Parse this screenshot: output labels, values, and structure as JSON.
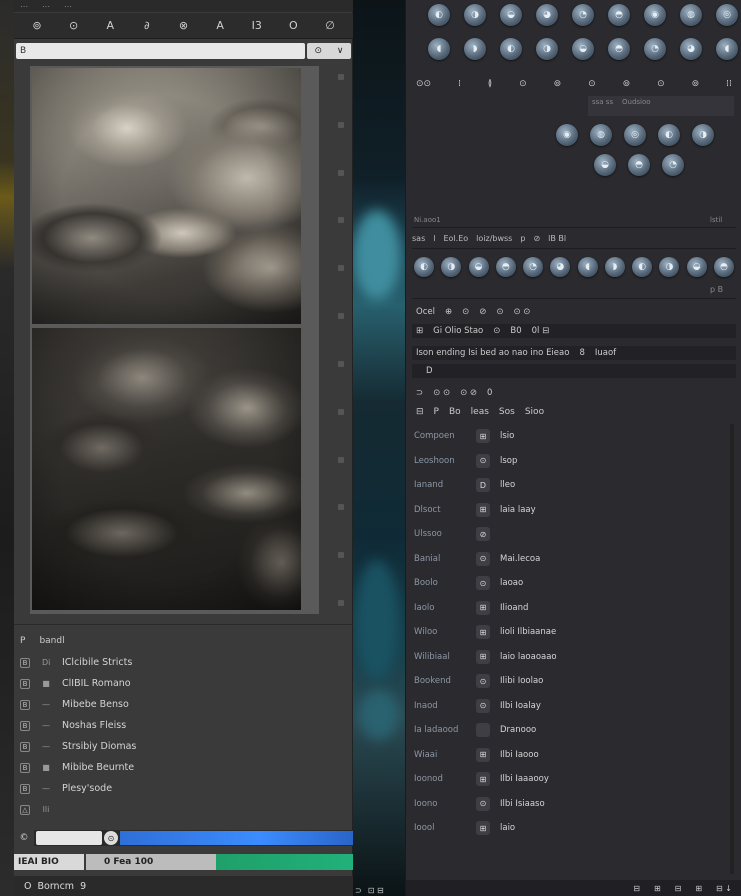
{
  "left_panel": {
    "toolbar_icons": [
      "⊚",
      "⊙",
      "A",
      "∂",
      "⊗",
      "A",
      "I3",
      "O",
      "∅"
    ],
    "path_value": "B",
    "path_buttons": [
      "⊙",
      "∨"
    ],
    "list_header_icon": "P",
    "list_header": "bandl",
    "rows": [
      {
        "mark": "B",
        "bullet": "Di",
        "label": "IClcibile Stricts"
      },
      {
        "mark": "B",
        "bullet": "■",
        "label": "ClIBIL Romano"
      },
      {
        "mark": "B",
        "bullet": "—",
        "label": "Mibebe Benso"
      },
      {
        "mark": "B",
        "bullet": "—",
        "label": "Noshas Fleiss"
      },
      {
        "mark": "B",
        "bullet": "—",
        "label": "Strsibiy Diomas"
      },
      {
        "mark": "B",
        "bullet": "■",
        "label": "Mibibe Beurnte"
      },
      {
        "mark": "B",
        "bullet": "—",
        "label": "Plesy'sode"
      },
      {
        "mark": "△",
        "bullet": "lli",
        "label": ""
      }
    ],
    "progress_cap": "©",
    "progress_btn": "⊙",
    "progress_fill": 1.0,
    "status_seg1": "IEAI BIO",
    "status_seg2": "0 Fea 100",
    "bottom_icon": "O",
    "bottom_label": "Borncm",
    "bottom_extra": "9"
  },
  "right_panel": {
    "palette_row1": [
      "◐",
      "◑",
      "◒",
      "◕",
      "◔",
      "◓",
      "◉",
      "◍",
      "◎"
    ],
    "palette_row2": [
      "◖",
      "◗",
      "◐",
      "◑",
      "◒",
      "◓",
      "◔",
      "◕",
      "◖"
    ],
    "iconbar": [
      "⊙⊙",
      "⁞",
      "≬",
      "⊙",
      "⊚",
      "⊙",
      "⊚",
      "⊙",
      "⊚",
      "⁞⁞"
    ],
    "sub_labels": [
      "ssa ss",
      "Oudsioo"
    ],
    "palette_row3": [
      "◉",
      "◍",
      "◎",
      "◐",
      "◑"
    ],
    "palette_row4": [
      "◒",
      "◓",
      "◔"
    ],
    "small_label_left": "Ni.aoo1",
    "small_label_right": "lstil",
    "tabline": [
      "sas",
      "l",
      "Eol.Eo",
      "loiz/bwss",
      "p",
      "⊘",
      "lB Bl"
    ],
    "colors": [
      "◐",
      "◑",
      "◒",
      "◓",
      "◔",
      "◕",
      "◖",
      "◗",
      "◐",
      "◑",
      "◒",
      "◓"
    ],
    "pill_label": "p B",
    "bar1": [
      "Ocel",
      "⊕",
      "⊙",
      "⊘",
      "⊙",
      "⊙ ⊙"
    ],
    "bar2": [
      "⊞",
      "Gi Olio Stao",
      "⊙",
      "B0",
      "0l ⊟"
    ],
    "bar3": [
      "Ison ending Isi bed ao nao ino Eieao",
      "8",
      "Iuaof"
    ],
    "bar4": [
      "",
      "D"
    ],
    "headbar": [
      "⊃",
      "⊙ ⊙",
      "⊙ ⊘",
      "0"
    ],
    "headrow": [
      "⊟",
      "P",
      "Bo",
      "leas",
      "Sos",
      "Sioo"
    ],
    "props": [
      {
        "label": "Compoen",
        "icon": "⊞",
        "value": "lsio"
      },
      {
        "label": "Leoshoon",
        "icon": "⊙",
        "value": "lsop"
      },
      {
        "label": "Ianand",
        "icon": "D",
        "value": "lleo"
      },
      {
        "label": "Dlsoct",
        "icon": "⊞",
        "value": "laia laay"
      },
      {
        "label": "Ulssoo",
        "icon": "⊘",
        "value": ""
      },
      {
        "label": "Banial",
        "icon": "⊙",
        "value": "Mai.lecoa"
      },
      {
        "label": "Boolo",
        "icon": "⊙",
        "value": "laoao"
      },
      {
        "label": "Iaolo",
        "icon": "⊞",
        "value": "Ilioand"
      },
      {
        "label": "Wiloo",
        "icon": "⊞",
        "value": "lioli Ilbiaanae"
      },
      {
        "label": "Wilibiaal",
        "icon": "⊞",
        "value": "laio laoaoaao"
      },
      {
        "label": "Bookend",
        "icon": "⊙",
        "value": "Ilibi Ioolao"
      },
      {
        "label": "Inaod",
        "icon": "⊙",
        "value": "Ilbi Ioalay"
      },
      {
        "label": "Ia ladaood",
        "icon": "",
        "value": "Dranooo"
      },
      {
        "label": "Wiaai",
        "icon": "⊞",
        "value": "Ilbi Iaooo"
      },
      {
        "label": "Ioonod",
        "icon": "⊞",
        "value": "Ilbi Iaaaooy"
      },
      {
        "label": "Ioono",
        "icon": "⊙",
        "value": "Ilbi Isiaaso"
      },
      {
        "label": "Ioool",
        "icon": "⊞",
        "value": "laio"
      }
    ],
    "footer": [
      "⊟",
      "⊞",
      "⊟",
      "⊞",
      "⊟ ↓"
    ],
    "mid_footer": [
      "⊃",
      "⊡ ⊟"
    ]
  }
}
